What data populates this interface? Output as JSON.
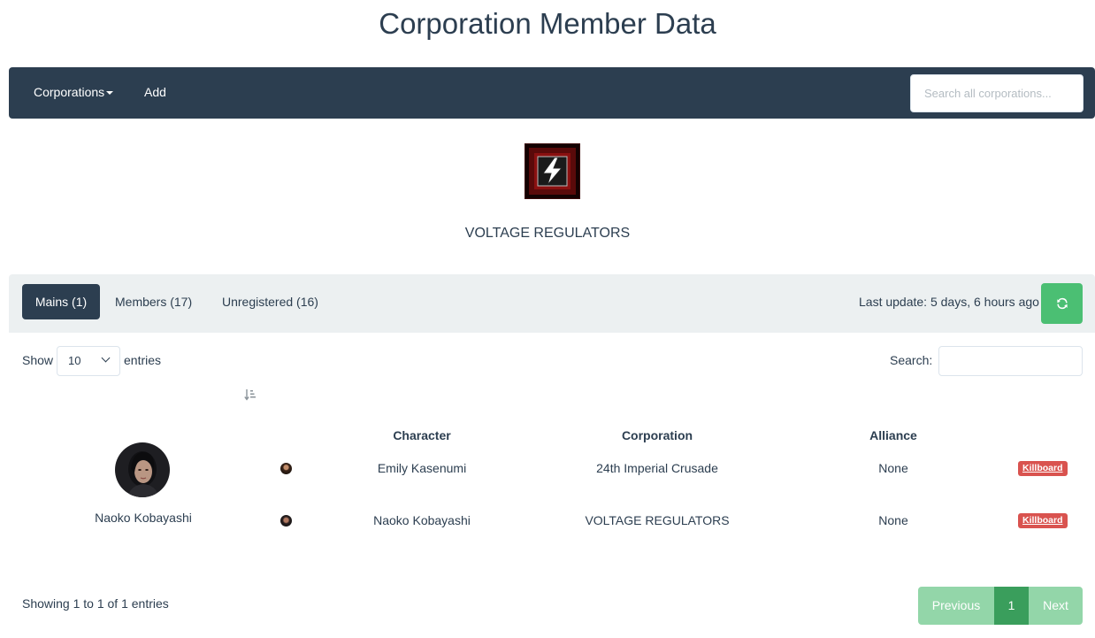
{
  "page": {
    "title": "Corporation Member Data"
  },
  "navbar": {
    "corporations_label": "Corporations",
    "add_label": "Add",
    "search_placeholder": "Search all corporations..."
  },
  "corporation": {
    "name": "VOLTAGE REGULATORS",
    "logo_icon": "lightning-bolt-icon"
  },
  "tabs": [
    {
      "label": "Mains (1)",
      "active": true
    },
    {
      "label": "Members (17)",
      "active": false
    },
    {
      "label": "Unregistered (16)",
      "active": false
    }
  ],
  "last_update": "Last update: 5 days, 6 hours ago",
  "table_controls": {
    "show_label": "Show",
    "page_length": "10",
    "entries_label": "entries",
    "search_label": "Search:",
    "search_value": ""
  },
  "table": {
    "columns": [
      "Character",
      "Corporation",
      "Alliance"
    ],
    "main": {
      "name": "Naoko Kobayashi"
    },
    "rows": [
      {
        "character": "Emily Kasenumi",
        "corporation": "24th Imperial Crusade",
        "alliance": "None",
        "killboard": "Killboard"
      },
      {
        "character": "Naoko Kobayashi",
        "corporation": "VOLTAGE REGULATORS",
        "alliance": "None",
        "killboard": "Killboard"
      }
    ]
  },
  "pagination": {
    "info": "Showing 1 to 1 of 1 entries",
    "previous": "Previous",
    "current": "1",
    "next": "Next"
  },
  "colors": {
    "primary": "#2c3e50",
    "success": "#4bbf73",
    "danger": "#d9534f",
    "light": "#ecf0f1"
  }
}
